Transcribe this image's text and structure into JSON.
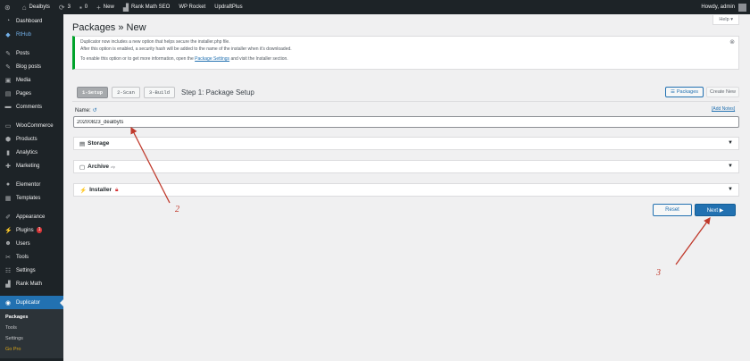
{
  "adminbar": {
    "site_name": "Dealbyts",
    "updates_count": "3",
    "comments_count": "0",
    "new_label": "New",
    "rank_math": "Rank Math SEO",
    "wp_rocket": "WP Rocket",
    "updraft": "UpdraftPlus",
    "howdy": "Howdy, admin"
  },
  "sidebar": {
    "items": [
      {
        "label": "Dashboard",
        "icon": "dashboard-icon"
      },
      {
        "label": "RtHub",
        "icon": "rthub-icon"
      },
      {
        "label": "Posts",
        "icon": "pin-icon"
      },
      {
        "label": "Blog posts",
        "icon": "pin-icon"
      },
      {
        "label": "Media",
        "icon": "media-icon"
      },
      {
        "label": "Pages",
        "icon": "pages-icon"
      },
      {
        "label": "Comments",
        "icon": "comments-icon"
      },
      {
        "label": "WooCommerce",
        "icon": "woo-icon"
      },
      {
        "label": "Products",
        "icon": "products-icon"
      },
      {
        "label": "Analytics",
        "icon": "analytics-icon"
      },
      {
        "label": "Marketing",
        "icon": "marketing-icon"
      },
      {
        "label": "Elementor",
        "icon": "elementor-icon"
      },
      {
        "label": "Templates",
        "icon": "templates-icon"
      },
      {
        "label": "Appearance",
        "icon": "appearance-icon"
      },
      {
        "label": "Plugins",
        "icon": "plugins-icon",
        "badge": "1"
      },
      {
        "label": "Users",
        "icon": "users-icon"
      },
      {
        "label": "Tools",
        "icon": "tools-icon"
      },
      {
        "label": "Settings",
        "icon": "settings-icon"
      },
      {
        "label": "Rank Math",
        "icon": "rankmath-icon"
      },
      {
        "label": "Duplicator",
        "icon": "duplicator-icon"
      }
    ],
    "submenu": [
      "Packages",
      "Tools",
      "Settings",
      "Go Pro"
    ]
  },
  "help_tab": "Help",
  "page_title": "Packages » New",
  "notice": {
    "line1": "Duplicator now includes a new option that helps secure the installer.php file.",
    "line2": "After this option is enabled, a security hash will be added to the name of the installer when it's downloaded.",
    "line3_pre": "To enable this option or to get more information, open the",
    "line3_link": "Package Settings",
    "line3_post": "and visit the Installer section."
  },
  "steps": {
    "s1": "1-Setup",
    "s2": "2-Scan",
    "s3": "3-Build",
    "title": "Step 1: Package Setup"
  },
  "buttons": {
    "packages": "Packages",
    "create_new": "Create New",
    "reset": "Reset",
    "next": "Next ▶"
  },
  "form": {
    "name_label": "Name:",
    "add_notes": "[Add Notes]",
    "name_value": "20200823_dealbyts"
  },
  "sections": {
    "storage": "Storage",
    "archive": "Archive",
    "archive_sup": "zip",
    "installer": "Installer"
  },
  "annotations": {
    "two": "2",
    "three": "3"
  },
  "colors": {
    "accent": "#2271b1",
    "admin_dark": "#1d2327",
    "notice_border": "#00a32a",
    "annotation": "#c0392b"
  }
}
